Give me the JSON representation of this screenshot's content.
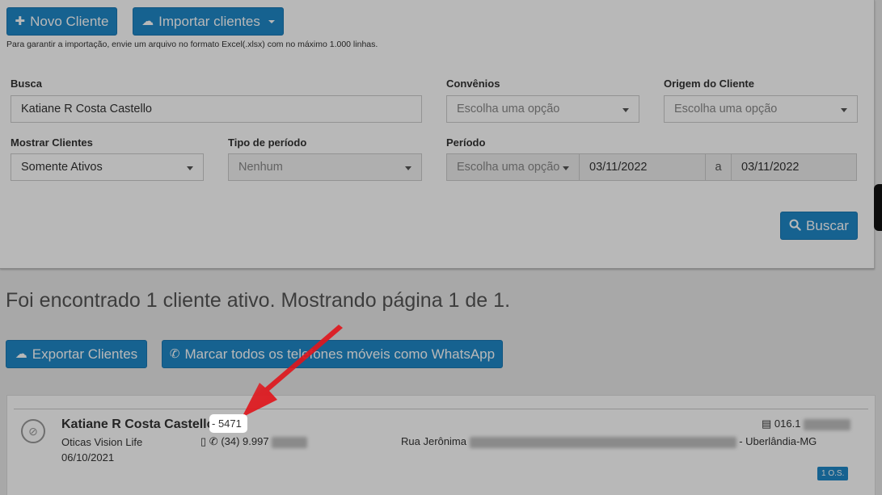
{
  "toolbar": {
    "new_client_label": "Novo Cliente",
    "import_label": "Importar clientes",
    "import_help": "Para garantir a importação, envie um arquivo no formato Excel(.xlsx) com no máximo 1.000 linhas."
  },
  "filters": {
    "busca_label": "Busca",
    "busca_value": "Katiane R Costa Castello",
    "convenios_label": "Convênios",
    "convenios_value": "Escolha uma opção",
    "origem_label": "Origem do Cliente",
    "origem_value": "Escolha uma opção",
    "mostrar_label": "Mostrar Clientes",
    "mostrar_value": "Somente Ativos",
    "tipo_label": "Tipo de período",
    "tipo_value": "Nenhum",
    "periodo_label": "Período",
    "periodo_select": "Escolha uma opção",
    "periodo_from": "03/11/2022",
    "periodo_sep": "a",
    "periodo_to": "03/11/2022",
    "search_button": "Buscar"
  },
  "results": {
    "summary": "Foi encontrado 1 cliente ativo. Mostrando página 1 de 1.",
    "export_label": "Exportar Clientes",
    "whatsapp_label": "Marcar todos os telefones móveis como WhatsApp"
  },
  "client": {
    "name": "Katiane R Costa Castello",
    "id": "5471",
    "company": "Oticas Vision Life",
    "date": "06/10/2021",
    "phone": "(34) 9.997",
    "address_start": "Rua Jerônima",
    "city": "- Uberlândia-MG",
    "doc": "016.1",
    "os_badge": "1 O.S."
  },
  "colors": {
    "primary": "#1f88c8",
    "arrow": "#e0151b"
  },
  "icons": {
    "plus": "plus-icon",
    "cloud_upload": "cloud-upload-icon",
    "search": "search-icon",
    "cloud_download": "cloud-download-icon",
    "whatsapp": "whatsapp-icon",
    "phone": "mobile-phone-icon",
    "card": "id-card-icon",
    "camera": "camera-icon"
  }
}
